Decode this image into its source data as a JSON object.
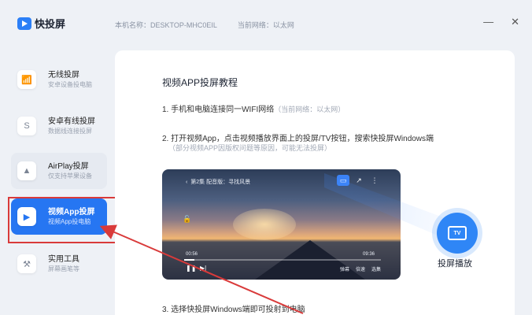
{
  "app": {
    "name": "快投屏"
  },
  "header": {
    "device_name": "本机名称：DESKTOP-MHC0EIL",
    "network": "当前网络：以太网"
  },
  "window_controls": {
    "minimize": "—",
    "close": "✕"
  },
  "sidebar": {
    "items": [
      {
        "title": "无线投屏",
        "subtitle": "安卓设备投电脑",
        "icon": "wifi-cast-icon",
        "active": false
      },
      {
        "title": "安卓有线投屏",
        "subtitle": "数据线连接投屏",
        "icon": "usb-cable-icon",
        "active": false
      },
      {
        "title": "AirPlay投屏",
        "subtitle": "仅支持苹果设备",
        "icon": "airplay-icon",
        "active": false
      },
      {
        "title": "视频App投屏",
        "subtitle": "视频App投电脑",
        "icon": "video-app-icon",
        "active": true
      },
      {
        "title": "实用工具",
        "subtitle": "屏幕画笔等",
        "icon": "toolbox-icon",
        "active": false
      }
    ]
  },
  "main": {
    "title": "视频APP投屏教程",
    "step1": "1. 手机和电脑连接同一WIFI网络",
    "step1_note": "（当前网络：以太网）",
    "step2": "2. 打开视频App，点击视频播放界面上的投屏/TV按钮，搜索快投屏Windows端",
    "step2_note": "（部分视频APP因版权问题等原因，可能无法投屏）",
    "step3": "3. 选择快投屏Windows端即可投射到电脑"
  },
  "video_player": {
    "title": "第2集 配音版：寻找风景",
    "current_time": "00:56",
    "total_time": "09:36",
    "progress": 0.05,
    "quality_options": [
      "弹幕",
      "倍速",
      "选集"
    ]
  },
  "tv_badge": {
    "label": "投屏播放",
    "icon_text": "TV"
  },
  "colors": {
    "accent": "#2676f2",
    "annotation": "#d93a3a"
  }
}
